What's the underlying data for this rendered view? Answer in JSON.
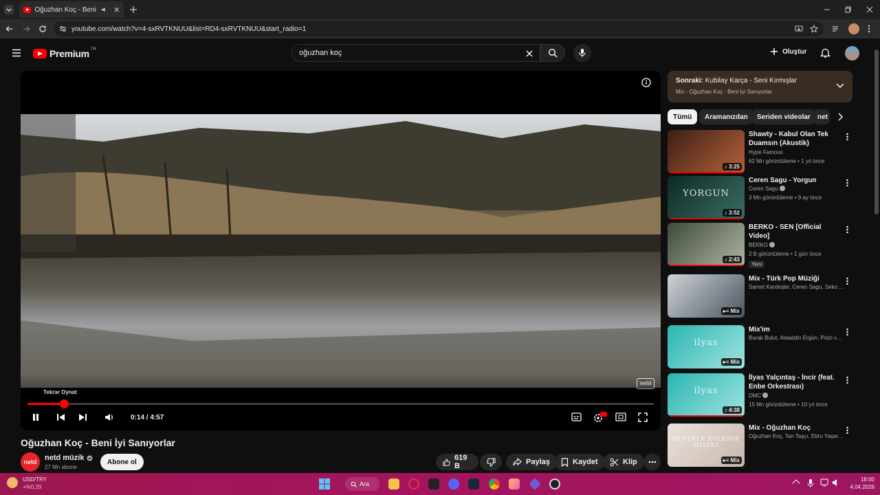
{
  "browser": {
    "tab_title": "Oğuzhan Koç - Beni İyi Sanıyorlar",
    "url": "youtube.com/watch?v=4-sxRVTKNUU&list=RD4-sxRVTKNUU&start_radio=1"
  },
  "header": {
    "logo_text": "Premium",
    "region": "TR",
    "search_value": "oğuzhan koç",
    "create_label": "Oluştur"
  },
  "player": {
    "replay_tooltip": "Tekrar Oynat",
    "time": "0:14 / 4:57",
    "progress_fraction": 0.058,
    "watermark": "netd"
  },
  "video": {
    "title": "Oğuzhan Koç - Beni İyi Sanıyorlar",
    "channel": "netd müzik",
    "channel_avatar_text": "netd",
    "subscribers": "27 Mn abone",
    "subscribe_label": "Abone ol",
    "likes": "619 B",
    "share_label": "Paylaş",
    "save_label": "Kaydet",
    "clip_label": "Klip"
  },
  "upnext": {
    "prefix": "Sonraki:",
    "title": "Kubilay Karça - Seni Kırmışlar",
    "subtitle": "Mix - Oğuzhan Koç - Beni İyi Sanıyorlar"
  },
  "chips": [
    "Tümü",
    "Aramanızdan",
    "Seriden videolar",
    "net"
  ],
  "recommendations": [
    {
      "title": "Shawty - Kabul Olan Tek Duamsın (Akustik)",
      "channel": "Hype Famous",
      "verified": false,
      "meta": "62 Mn görüntüleme • 1 yıl önce",
      "badge": "3:25",
      "mix": false,
      "new": "",
      "colors": [
        "#3b1f16",
        "#b5623a"
      ]
    },
    {
      "title": "Ceren Sagu - Yorgun",
      "channel": "Ceren Sagu",
      "verified": true,
      "meta": "3 Mn görüntüleme • 9 ay önce",
      "badge": "3:52",
      "mix": false,
      "new": "",
      "thumb_text": "YORGUN",
      "colors": [
        "#0e2a26",
        "#3a6e62"
      ]
    },
    {
      "title": "BERKO - SEN [Official Video]",
      "channel": "BERKO",
      "verified": true,
      "meta": "2 B görüntüleme • 1 gün önce",
      "badge": "2:43",
      "mix": false,
      "new": "Yeni",
      "colors": [
        "#3f4a3a",
        "#aeb5a5"
      ]
    },
    {
      "title": "Mix - Türk Pop Müziği",
      "channel": "Samet Kardeşler, Ceren Sagu, Seko ve da...",
      "verified": false,
      "meta": "",
      "badge": "Mix",
      "mix": true,
      "new": "",
      "colors": [
        "#cfd3d8",
        "#4a5660"
      ]
    },
    {
      "title": "Mix'im",
      "channel": "Burak Bulut, Alaaddin Ergün, Poizi ve dah...",
      "verified": false,
      "meta": "",
      "badge": "Mix",
      "mix": true,
      "new": "",
      "thumb_text": "ilyas",
      "colors": [
        "#2bb5b0",
        "#9ee3e0"
      ]
    },
    {
      "title": "İlyas Yalçıntaş - İncir (feat. Enbe Orkestrası)",
      "channel": "DMC",
      "verified": true,
      "meta": "15 Mn görüntüleme • 10 yıl önce",
      "badge": "4:38",
      "mix": false,
      "new": "",
      "thumb_text": "ilyas",
      "colors": [
        "#2bb5b0",
        "#9ee3e0"
      ]
    },
    {
      "title": "Mix - Oğuzhan Koç",
      "channel": "Oğuzhan Koç, Tan Taşçı, Ebru Yaşar ve d...",
      "verified": false,
      "meta": "",
      "badge": "Mix",
      "mix": true,
      "new": "",
      "thumb_text": "BENİMLE EVLENİR MİSİN?",
      "colors": [
        "#e9e2dc",
        "#c9b7ad"
      ]
    }
  ],
  "taskbar": {
    "ticker_name": "USD/TRY",
    "ticker_change": "+%0,29",
    "search_label": "Ara",
    "time": "18:00",
    "date": "4.04.2026"
  },
  "colors": {
    "accent": "#ff0000",
    "taskbar": "#a4145e",
    "upnext_bg": "#3a2c20"
  }
}
